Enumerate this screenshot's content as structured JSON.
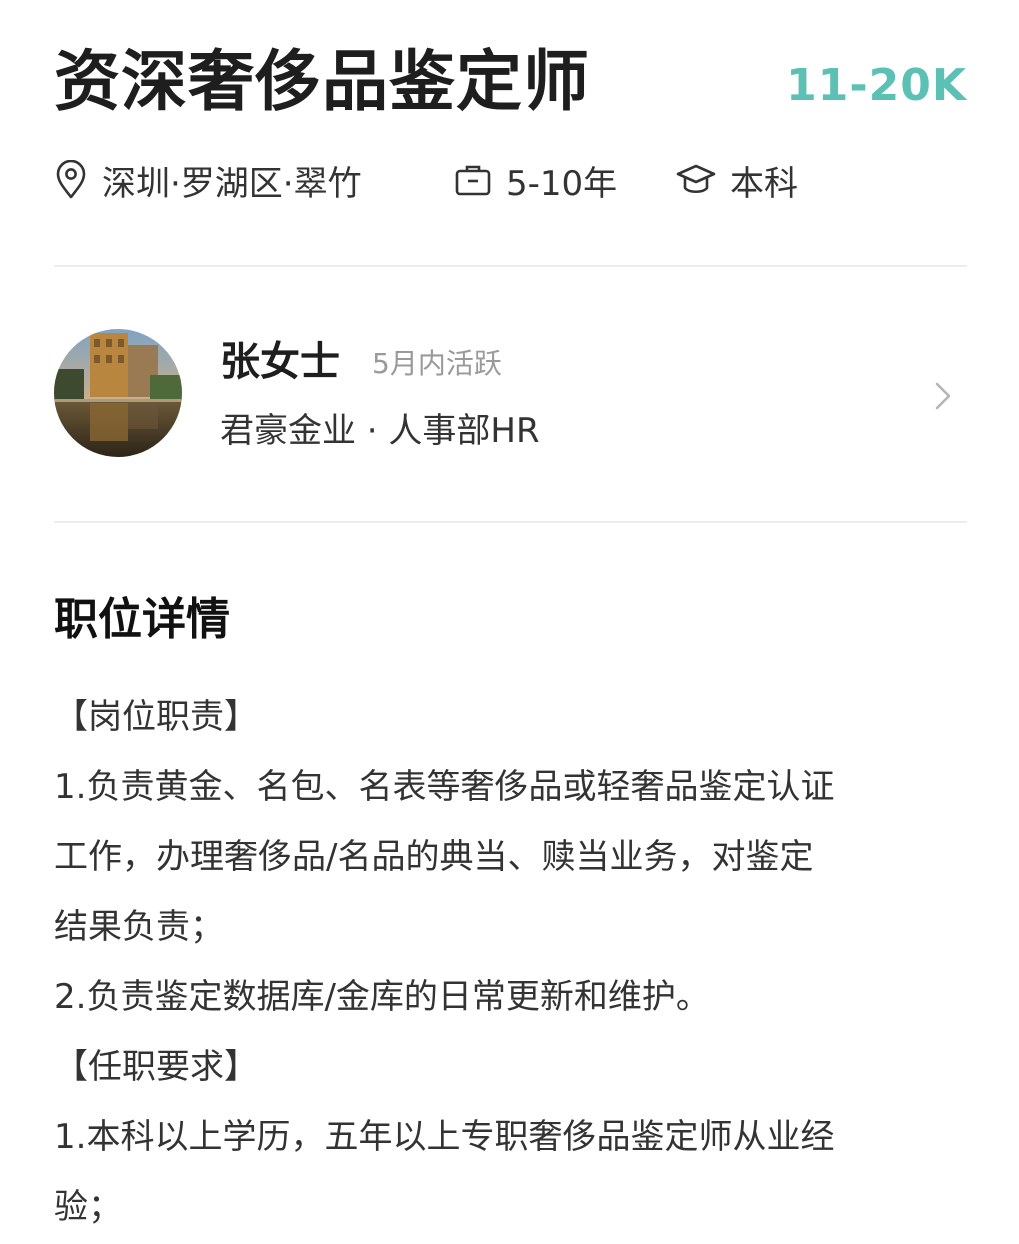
{
  "job": {
    "title": "资深奢侈品鉴定师",
    "salary": "11-20K",
    "location": "深圳·罗湖区·翠竹",
    "experience": "5-10年",
    "education": "本科",
    "icons": [
      "location-pin-icon",
      "briefcase-icon",
      "graduation-cap-icon"
    ]
  },
  "recruiter": {
    "name": "张女士",
    "status": "5月内活跃",
    "company": "君豪金业 · 人事部HR"
  },
  "details": {
    "title": "职位详情",
    "lines": [
      "【岗位职责】",
      "1.负责黄金、名包、名表等奢侈品或轻奢品鉴定认证",
      "工作，办理奢侈品/名品的典当、赎当业务，对鉴定",
      "结果负责；",
      "2.负责鉴定数据库/金库的日常更新和维护。",
      "【任职要求】",
      "1.本科以上学历，五年以上专职奢侈品鉴定师从业经",
      "验；"
    ]
  },
  "colors": {
    "salary": "#5cc0b4",
    "divider": "#ececec",
    "muted_text": "#9a9a9a"
  }
}
